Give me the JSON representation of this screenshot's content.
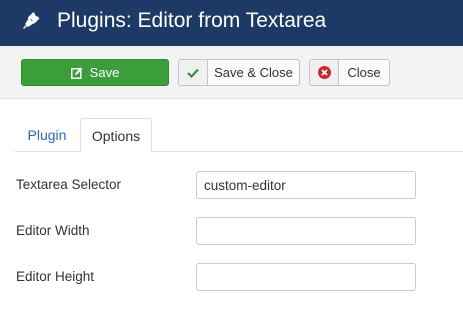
{
  "header": {
    "title": "Plugins: Editor from Textarea",
    "icon": "plug-icon"
  },
  "toolbar": {
    "save_label": "Save",
    "save_close_label": "Save & Close",
    "close_label": "Close"
  },
  "tabs": [
    {
      "label": "Plugin",
      "active": false
    },
    {
      "label": "Options",
      "active": true
    }
  ],
  "form": {
    "textarea_selector": {
      "label": "Textarea Selector",
      "value": "custom-editor"
    },
    "editor_width": {
      "label": "Editor Width",
      "value": ""
    },
    "editor_height": {
      "label": "Editor Height",
      "value": ""
    }
  },
  "colors": {
    "header_bg": "#1d3a66",
    "save_green": "#3b9e3b",
    "check_green": "#3b8a3b",
    "close_red": "#c72a2a",
    "tab_link": "#2a69b8"
  }
}
